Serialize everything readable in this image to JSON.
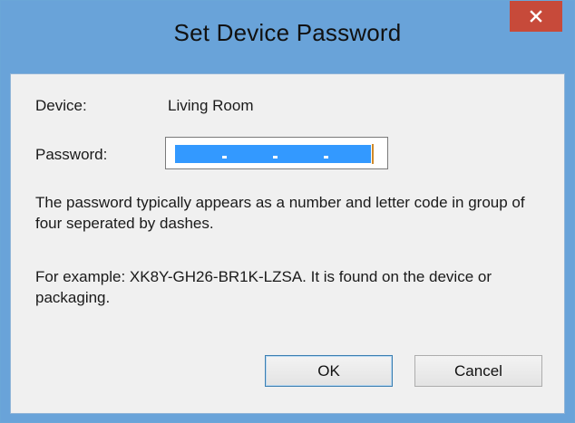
{
  "window": {
    "title": "Set Device Password",
    "close_icon": "close-icon",
    "accent_color": "#69a3d9",
    "close_color": "#c74a3a"
  },
  "device": {
    "label": "Device:",
    "value": "Living Room"
  },
  "password": {
    "label": "Password:",
    "selected": true
  },
  "info": {
    "line1": "The password typically appears as a number and letter code in group of four seperated by dashes.",
    "line2": "For example: XK8Y-GH26-BR1K-LZSA. It is found on the device or packaging."
  },
  "buttons": {
    "ok": "OK",
    "cancel": "Cancel"
  }
}
